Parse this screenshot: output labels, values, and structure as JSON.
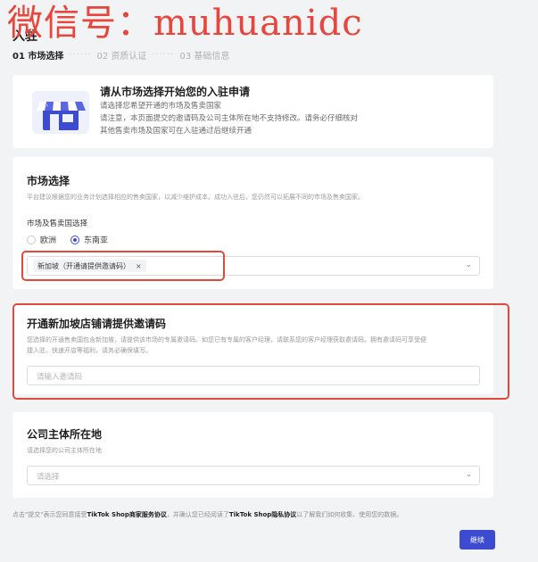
{
  "watermark": "微信号：muhuanidc",
  "page": {
    "title": "入驻",
    "steps": [
      {
        "label": "01 市场选择",
        "active": true
      },
      {
        "label": "02 资质认证",
        "active": false
      },
      {
        "label": "03 基础信息",
        "active": false
      }
    ],
    "step_separator": "······"
  },
  "intro": {
    "title": "请从市场选择开始您的入驻申请",
    "lines": [
      "请选择您希望开通的市场及售卖国家",
      "请注意，本页面提交的邀请码及公司主体所在地不支持修改。请务必仔细核对",
      "其他售卖市场及国家可在入驻通过后继续开通"
    ]
  },
  "market": {
    "title": "市场选择",
    "subtitle": "平台建议根据您的业务计划选择相应的售卖国家，以减少维护成本。成功入驻后，您仍然可以拓展不同的市场及售卖国家。",
    "field_label": "市场及售卖国选择",
    "options": [
      "欧洲",
      "东南亚"
    ],
    "selected_option": "东南亚",
    "selected_tag": "新加坡（开通请提供邀请码）",
    "tag_remove": "×"
  },
  "invite": {
    "title": "开通新加坡店铺请提供邀请码",
    "desc_line1": "您选择的开通售卖国包含新加坡，请提供该市场的专属邀请码。如您已有专属的客户经理，请联系您的客户经理获取邀请码。拥有邀请码可享受便",
    "desc_line2": "捷入驻、快速开店等福利，请务必确保填写。",
    "placeholder": "请输入邀请码"
  },
  "company": {
    "title": "公司主体所在地",
    "subtitle": "请选择您的公司主体所在地",
    "placeholder": "请选择"
  },
  "footer": {
    "prefix": "点击\"提交\"表示您同意接受",
    "link1": "TikTok Shop商家服务协议",
    "middle": "，并确认您已经阅读了",
    "link2": "TikTok Shop隐私协议",
    "suffix": "以了解我们如何收集、使用您的数据。"
  },
  "continue_label": "继续",
  "colors": {
    "accent": "#3d4bd1",
    "highlight_border": "#e04a3b",
    "watermark": "#e8453c"
  },
  "icons": {
    "select_arrow": "chevron-down-icon",
    "store": "storefront-icon"
  }
}
